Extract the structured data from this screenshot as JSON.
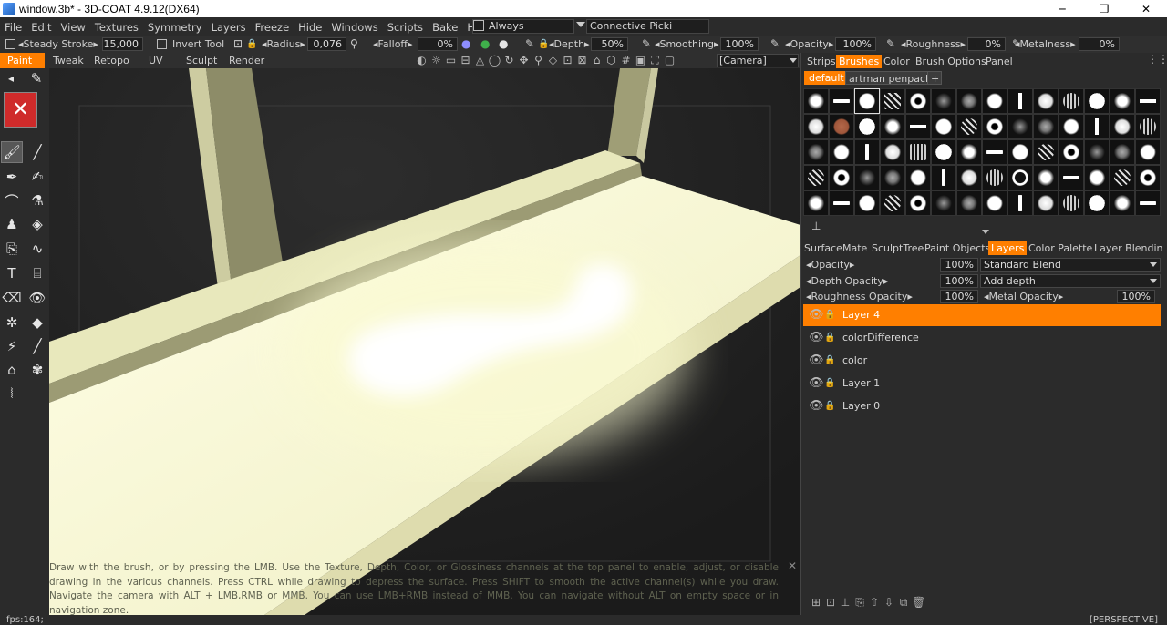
{
  "window": {
    "title": "window.3b* - 3D-COAT 4.9.12(DX64)",
    "minimize": "─",
    "maximize": "❐",
    "close": "✕"
  },
  "menu": [
    "File",
    "Edit",
    "View",
    "Textures",
    "Symmetry",
    "Layers",
    "Freeze",
    "Hide",
    "Windows",
    "Scripts",
    "Bake",
    "Help"
  ],
  "menu_extra": {
    "always": "Always",
    "picki": "Connective  Picki"
  },
  "params": {
    "steady_label": "Steady  Stroke",
    "steady_value": "15,000",
    "invert_label": "Invert  Tool",
    "radius_label": "Radius",
    "radius_value": "0,076",
    "falloff_label": "Falloff",
    "falloff_value": "0%",
    "depth_label": "Depth",
    "depth_value": "50%",
    "smoothing_label": "Smoothing",
    "smoothing_value": "100%",
    "opacity_label": "Opacity",
    "opacity_value": "100%",
    "roughness_label": "Roughness",
    "roughness_value": "0%",
    "metalness_label": "Metalness",
    "metalness_value": "0%"
  },
  "rooms": [
    "Paint",
    "Tweak",
    "Retopo",
    "UV",
    "Sculpt",
    "Render"
  ],
  "camera": "[Camera]",
  "panel_tabs": [
    "Strips",
    "Brushes",
    "Color",
    "Brush  Options",
    "Panel"
  ],
  "brush_packs": [
    "default",
    "artman  penpack",
    "+"
  ],
  "layer_tabs": [
    "Surface",
    "Mate",
    "SculptTree",
    "Paint  Objects",
    "Layers",
    "Color  Palette",
    "Layer  Blendin"
  ],
  "layer_props": {
    "opacity_label": "Opacity",
    "opacity_value": "100%",
    "blend_mode": "Standard  Blend",
    "depth_opacity_label": "Depth  Opacity",
    "depth_opacity_value": "100%",
    "depth_mode": "Add  depth",
    "roughness_opacity_label": "Roughness  Opacity",
    "roughness_opacity_value": "100%",
    "metal_opacity_label": "Metal  Opacity",
    "metal_opacity_value": "100%"
  },
  "layers": [
    "Layer  4",
    "colorDifference",
    "color",
    "Layer  1",
    "Layer  0"
  ],
  "hint": "Draw with the brush, or by pressing the LMB. Use the Texture, Depth, Color, or Glossiness channels at the top panel to enable, adjust, or disable drawing in the various channels. Press CTRL while drawing to depress the surface. Press SHIFT to smooth the active channel(s) while you draw. Navigate the camera with ALT + LMB,RMB or MMB. You can use LMB+RMB instead of MMB. You can navigate without ALT on empty space or in navigation zone.",
  "status": {
    "fps": "fps:164;",
    "view": "[PERSPECTIVE]"
  },
  "colors": {
    "accent": "#ff7f00",
    "swatch": "#cf2b2b",
    "model": "#f6f5c6"
  }
}
